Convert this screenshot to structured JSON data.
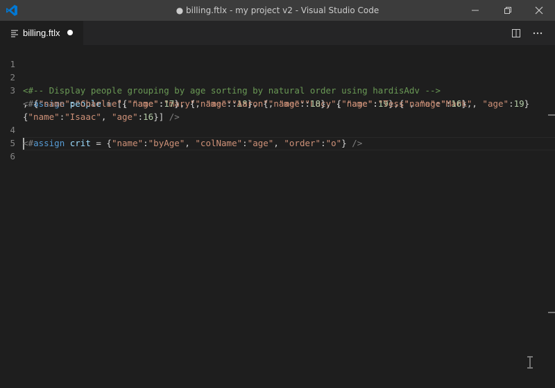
{
  "window": {
    "title": "● billing.ftlx - my project v2 - Visual Studio Code"
  },
  "tab": {
    "label": "billing.ftlx"
  },
  "editor": {
    "line_numbers": [
      "1",
      "2",
      "3",
      "4",
      "5",
      "6"
    ],
    "lines": {
      "l2": {
        "comment": "<#-- Display people grouping by age sorting by natural order using hardisAdv -->"
      },
      "l3a": {
        "open": "<#",
        "kw": "assign",
        "var": "people",
        "eq": " = [{",
        "s1": "\"name\"",
        "c1": ":",
        "s2": "\"mary\"",
        "c2": ", ",
        "s3": "\"age\"",
        "c3": ":",
        "n1": "18",
        "c4": "}, {",
        "s4": "\"name\"",
        "c5": ":",
        "s5": "\"Lucy\"",
        "c6": ", ",
        "s6": "\"age\"",
        "c7": ":",
        "n2": "19",
        "c8": "},{",
        "s7": "\"name\"",
        "c9": ":",
        "s8": "\"Mark\"",
        "c10": ", ",
        "s9": "\"age\"",
        "c11": ":",
        "n3": "19",
        "c12": "}"
      },
      "l3b": {
        "c1": ", {",
        "s1": "\"name\"",
        "c2": ":",
        "s2": "\"Charlie\"",
        "c3": ", ",
        "s3": "\"age\"",
        "c4": ":",
        "n1": "17",
        "c5": "}, {",
        "s4": "\"name\"",
        "c6": ":",
        "s5": "\"Aaron\"",
        "c7": ", ",
        "s6": "\"age\"",
        "c8": ":",
        "n2": "18",
        "c9": "}, {",
        "s7": "\"name\"",
        "c10": ":",
        "s8": "\"Tess\"",
        "c11": ", ",
        "s9": "\"age\"",
        "c12": ":",
        "n3": "16",
        "c13": "},"
      },
      "l3c": {
        "c1": "{",
        "s1": "\"name\"",
        "c2": ":",
        "s2": "\"Isaac\"",
        "c3": ", ",
        "s3": "\"age\"",
        "c4": ":",
        "n1": "16",
        "c5": "}] ",
        "close": "/>"
      },
      "l4": {
        "open": "<#",
        "kw": "assign",
        "var": "crit",
        "eq": " = {",
        "s1": "\"name\"",
        "c1": ":",
        "s2": "\"byAge\"",
        "c2": ", ",
        "s3": "\"colName\"",
        "c3": ":",
        "s4": "\"age\"",
        "c4": ", ",
        "s5": "\"order\"",
        "c5": ":",
        "s6": "\"o\"",
        "c6": "} ",
        "close": "/>"
      }
    }
  },
  "colors": {
    "titlebar": "#3c3c3c",
    "editor_bg": "#1e1e1e",
    "vscode_blue": "#0078d4",
    "comment": "#6a9955",
    "string": "#ce9178",
    "number": "#b5cea8",
    "keyword": "#569cd6",
    "variable": "#9cdcfe"
  },
  "icons": [
    "vscode-logo-icon",
    "minimize-icon",
    "restore-icon",
    "close-icon",
    "file-lines-icon",
    "split-editor-icon",
    "more-actions-icon",
    "text-cursor-icon"
  ]
}
